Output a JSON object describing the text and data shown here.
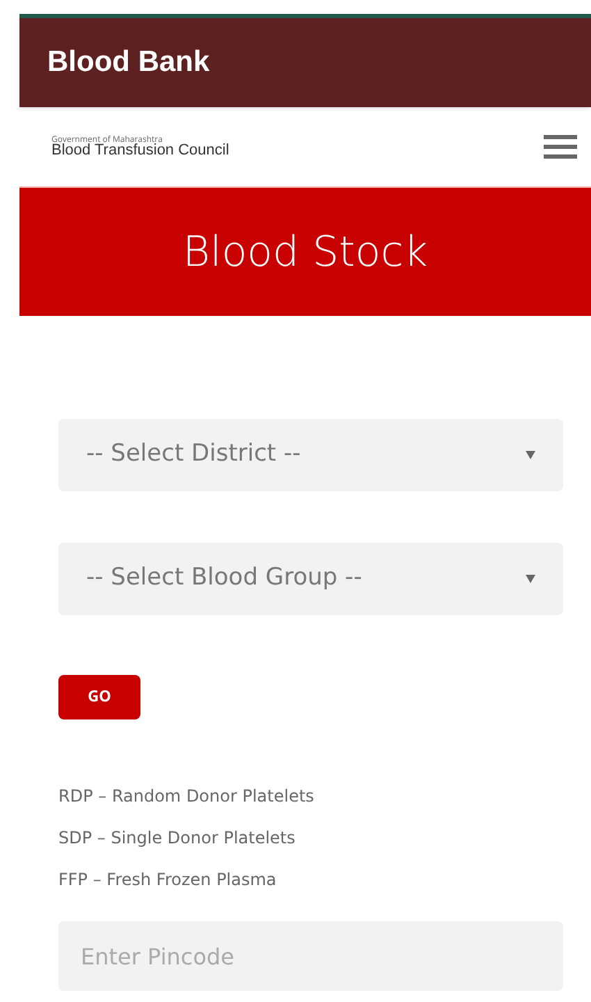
{
  "app_bar": {
    "title": "Blood Bank"
  },
  "header": {
    "subtitle": "Government of Maharashtra",
    "brand": "Blood Transfusion Council"
  },
  "banner": {
    "title": "Blood Stock"
  },
  "form": {
    "selects": [
      {
        "placeholder": "-- Select District --"
      },
      {
        "placeholder": "-- Select Blood Group --"
      }
    ],
    "go_button": "GO",
    "legend": [
      "RDP – Random Donor Platelets",
      "SDP – Single Donor Platelets",
      "FFP – Fresh Frozen Plasma"
    ],
    "pincode": {
      "placeholder": "Enter Pincode"
    }
  }
}
